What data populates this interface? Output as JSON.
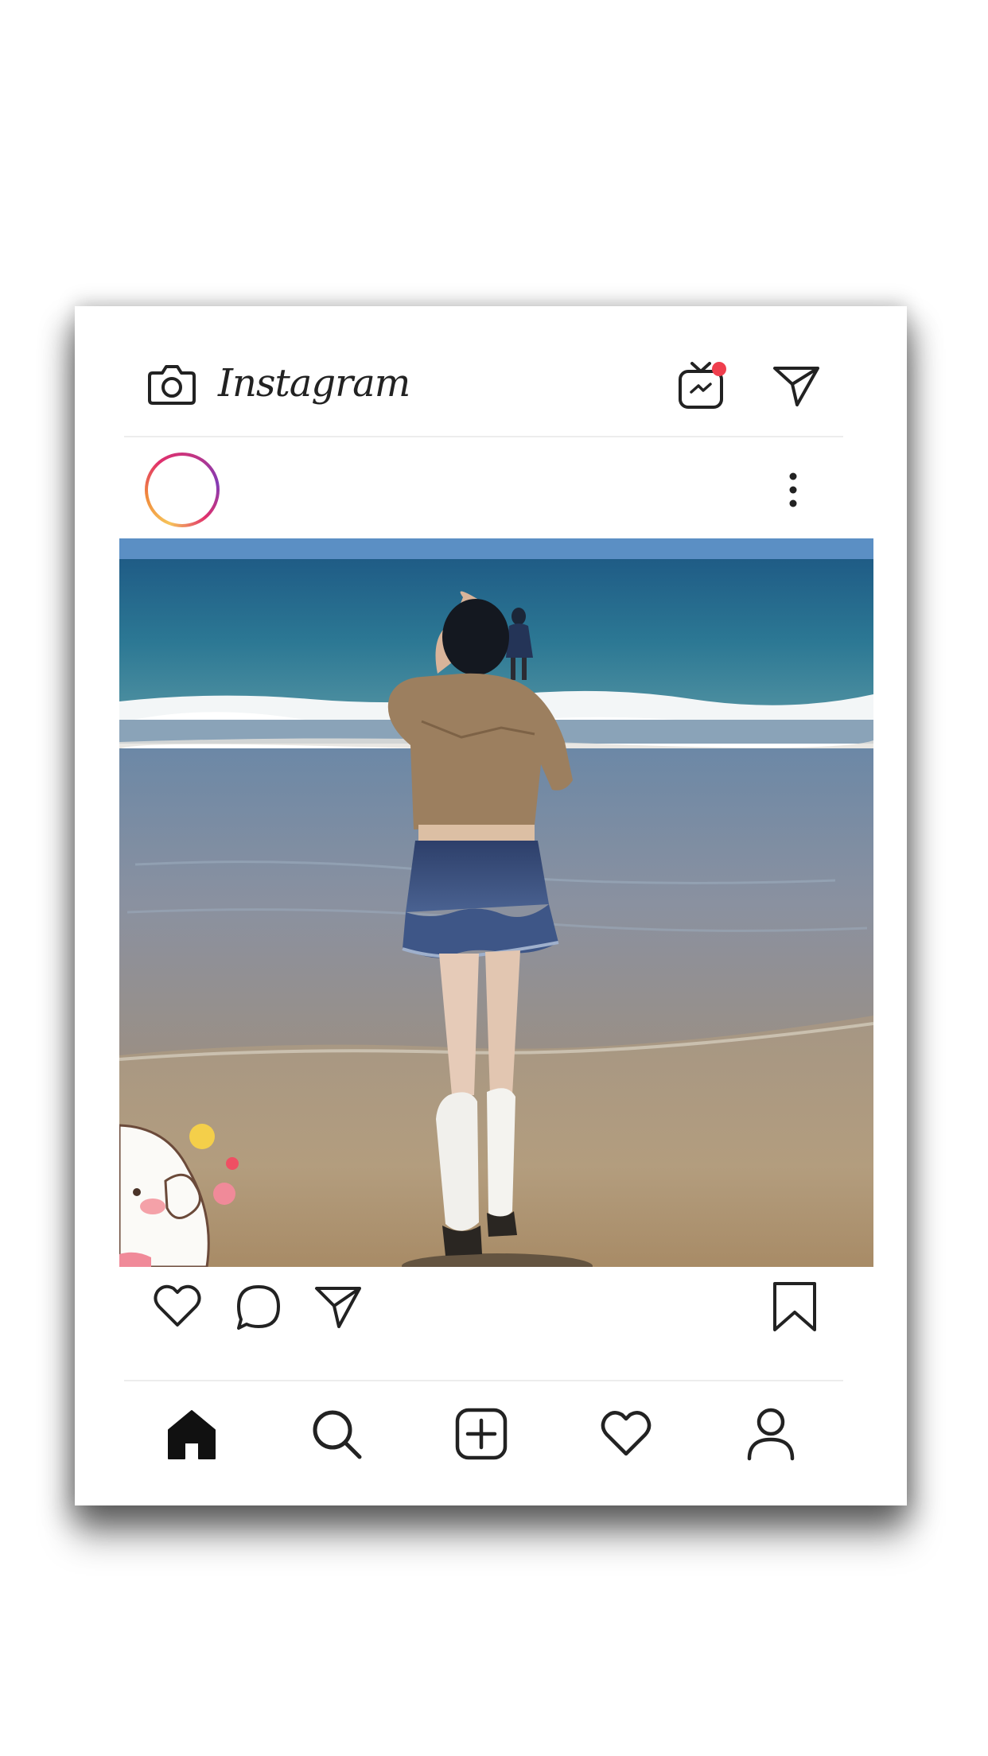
{
  "app": {
    "title": "Instagram"
  },
  "header": {
    "camera_icon": "camera-icon",
    "igtv_icon": "igtv-icon",
    "igtv_badge_color": "#ef3e4d",
    "direct_icon": "paper-plane-icon"
  },
  "post": {
    "avatar_ring_colors": [
      "#f6c45a",
      "#f08a3c",
      "#e1306c",
      "#c13584",
      "#833ab4"
    ],
    "menu_icon": "more-vertical-icon",
    "photo": "beach-photo",
    "actions": [
      "heart-icon",
      "comment-icon",
      "share-icon",
      "bookmark-icon"
    ]
  },
  "tabbar": {
    "tabs": [
      "home-icon",
      "search-icon",
      "add-post-icon",
      "activity-heart-icon",
      "profile-icon"
    ]
  }
}
